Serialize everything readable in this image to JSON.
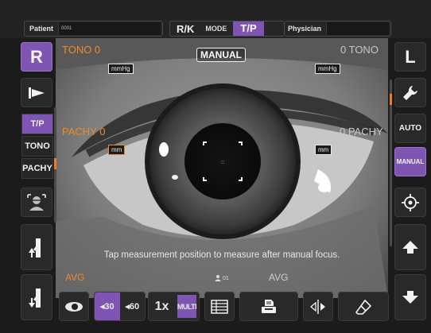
{
  "header": {
    "patient_label": "Patient",
    "patient_value": "0001",
    "rk_label": "R/K",
    "mode_label": "MODE",
    "tp_label": "T/P",
    "physician_label": "Physician",
    "physician_value": ""
  },
  "left_panel": {
    "eye_label": "R",
    "modes": [
      "T/P",
      "TONO",
      "PACHY"
    ],
    "active_mode": "T/P"
  },
  "right_panel": {
    "eye_label": "L",
    "auto_label": "AUTO",
    "manual_label": "MANUAL"
  },
  "view": {
    "manual_badge": "MANUAL",
    "tono_left": "TONO 0",
    "tono_right": "0 TONO",
    "pachy_left": "PACHY 0",
    "pachy_right": "0 PACHY",
    "unit_pressure": "mmHg",
    "unit_thickness": "mm",
    "hint": "Tap measurement position to measure after manual focus."
  },
  "bottom": {
    "avg_left": "AVG",
    "avg_right": "AVG",
    "count_label": "01",
    "interval_30": "30",
    "interval_60": "60",
    "x1_label": "1x",
    "multi_label": "MULTI"
  },
  "colors": {
    "accent": "#7e55b3",
    "orange": "#ef8a2c",
    "background": "#1b1b1b"
  }
}
